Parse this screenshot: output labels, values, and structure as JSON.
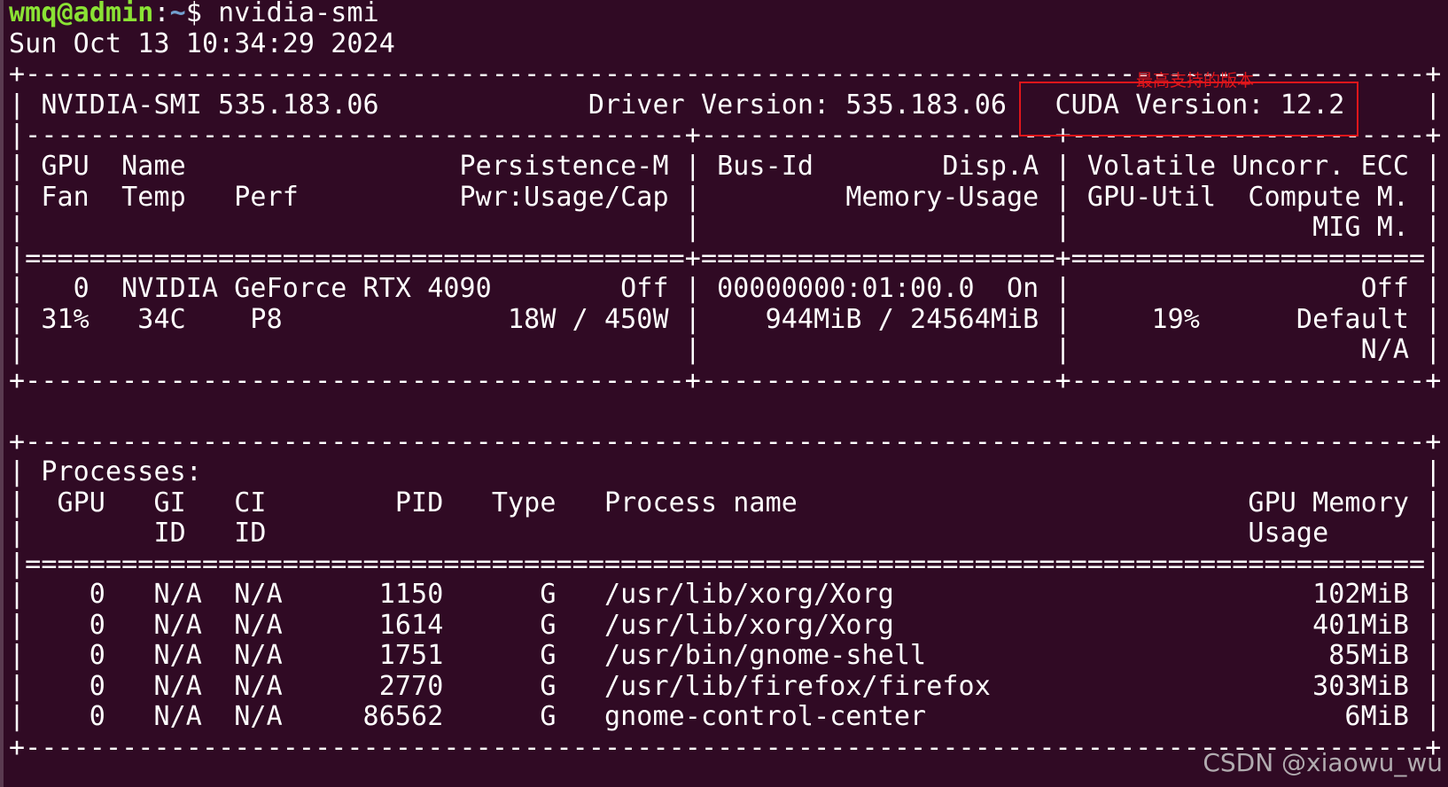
{
  "prompt": {
    "user_host": "wmq@admin",
    "separator": ":",
    "path": "~",
    "symbol": "$",
    "command": " nvidia-smi"
  },
  "timestamp": "Sun Oct 13 10:34:29 2024",
  "header": {
    "border_top": "+---------------------------------------------------------------------------------------+",
    "smi_line": "| NVIDIA-SMI 535.183.06             Driver Version: 535.183.06   CUDA Version: 12.2     |",
    "border_split": "|-----------------------------------------+----------------------+----------------------+"
  },
  "gpu_table": {
    "header_rows": [
      "| GPU  Name                 Persistence-M | Bus-Id        Disp.A | Volatile Uncorr. ECC |",
      "| Fan  Temp   Perf          Pwr:Usage/Cap |         Memory-Usage | GPU-Util  Compute M. |",
      "|                                         |                      |               MIG M. |"
    ],
    "separator": "|=========================================+======================+======================|",
    "rows": [
      "|   0  NVIDIA GeForce RTX 4090        Off | 00000000:01:00.0  On |                  Off |",
      "| 31%   34C    P8              18W / 450W |    944MiB / 24564MiB |     19%      Default |",
      "|                                         |                      |                  N/A |"
    ],
    "border_bottom": "+-----------------------------------------+----------------------+----------------------+"
  },
  "processes": {
    "border_top": "+---------------------------------------------------------------------------------------+",
    "title_row": "| Processes:                                                                            |",
    "header_rows": [
      "|  GPU   GI   CI        PID   Type   Process name                            GPU Memory |",
      "|        ID   ID                                                             Usage      |"
    ],
    "separator": "|=======================================================================================|",
    "rows": [
      "|    0   N/A  N/A      1150      G   /usr/lib/xorg/Xorg                          102MiB |",
      "|    0   N/A  N/A      1614      G   /usr/lib/xorg/Xorg                          401MiB |",
      "|    0   N/A  N/A      1751      G   /usr/bin/gnome-shell                         85MiB |",
      "|    0   N/A  N/A      2770      G   /usr/lib/firefox/firefox                    303MiB |",
      "|    0   N/A  N/A     86562      G   gnome-control-center                          6MiB |"
    ],
    "border_bottom": "+---------------------------------------------------------------------------------------+"
  },
  "annotation": {
    "note": "最高支持的版本",
    "box_color": "#e0161b"
  },
  "watermark": "CSDN @xiaowu_wu",
  "colors": {
    "background": "#300a24",
    "text": "#ffffff",
    "prompt_user": "#8ae234",
    "prompt_path": "#729fcf"
  }
}
